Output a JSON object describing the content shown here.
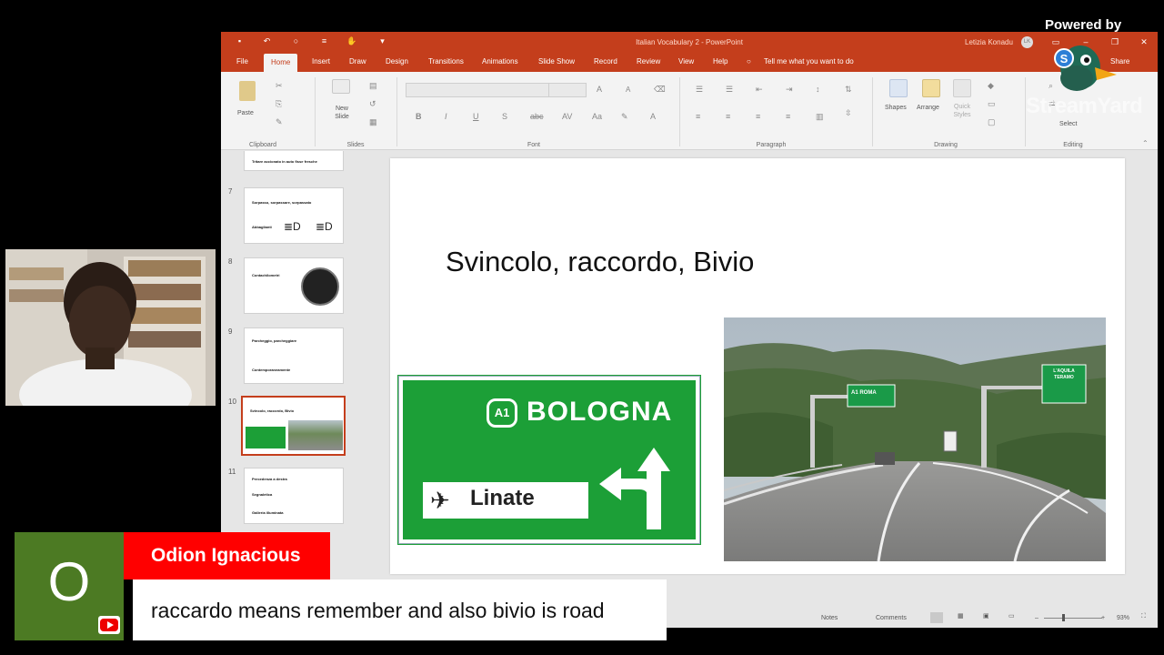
{
  "stream": {
    "powered_by": "Powered by",
    "brand": "StreamYard"
  },
  "window": {
    "doc_title": "Italian Vocabulary 2  -  PowerPoint",
    "user_name": "Letizia Konadu",
    "user_initials": "LK"
  },
  "tabs": [
    {
      "label": "File"
    },
    {
      "label": "Home"
    },
    {
      "label": "Insert"
    },
    {
      "label": "Draw"
    },
    {
      "label": "Design"
    },
    {
      "label": "Transitions"
    },
    {
      "label": "Animations"
    },
    {
      "label": "Slide Show"
    },
    {
      "label": "Record"
    },
    {
      "label": "Review"
    },
    {
      "label": "View"
    },
    {
      "label": "Help"
    }
  ],
  "tell_me": "Tell me what you want to do",
  "share_label": "Share",
  "ribbon": {
    "groups": {
      "clipboard": "Clipboard",
      "slides": "Slides",
      "font": "Font",
      "paragraph": "Paragraph",
      "drawing": "Drawing",
      "editing": "Editing"
    },
    "paste": "Paste",
    "new_slide": "New Slide",
    "shapes": "Shapes",
    "arrange": "Arrange",
    "quick_styles": "Quick Styles",
    "select": "Select"
  },
  "thumbnails": [
    {
      "num": "",
      "lines": [
        "Tritare accionato in auto   fisse fresche"
      ]
    },
    {
      "num": "7",
      "lines": [
        "Sorpasso, sorpassare, sorpassato",
        "Abbaglianti"
      ]
    },
    {
      "num": "8",
      "lines": [
        "Contachilometri"
      ]
    },
    {
      "num": "9",
      "lines": [
        "Parcheggio, parcheggiare",
        "Contemporaneamente"
      ]
    },
    {
      "num": "10",
      "lines": [
        "Svincolo, raccordo, Bivio"
      ]
    },
    {
      "num": "11",
      "lines": [
        "Precedenza a destra",
        "Segnaletica",
        "Galleria illuminata"
      ]
    }
  ],
  "slide": {
    "title": "Svincolo, raccordo, Bivio",
    "sign": {
      "road": "A1",
      "city": "BOLOGNA",
      "destination": "Linate"
    },
    "photo_signs": {
      "left": "A1 ROMA",
      "right": "L'AQUILA TERAMO"
    }
  },
  "status": {
    "notes": "Notes",
    "comments": "Comments",
    "zoom": "93%"
  },
  "comment": {
    "avatar_letter": "O",
    "name": "Odion Ignacious",
    "message": "raccardo means remember and also bivio is road"
  },
  "colors": {
    "ppt_accent": "#c43e1c",
    "sign_green": "#1c9f37",
    "comment_name_bg": "#ff0000",
    "avatar_bg": "#4c7a23"
  }
}
